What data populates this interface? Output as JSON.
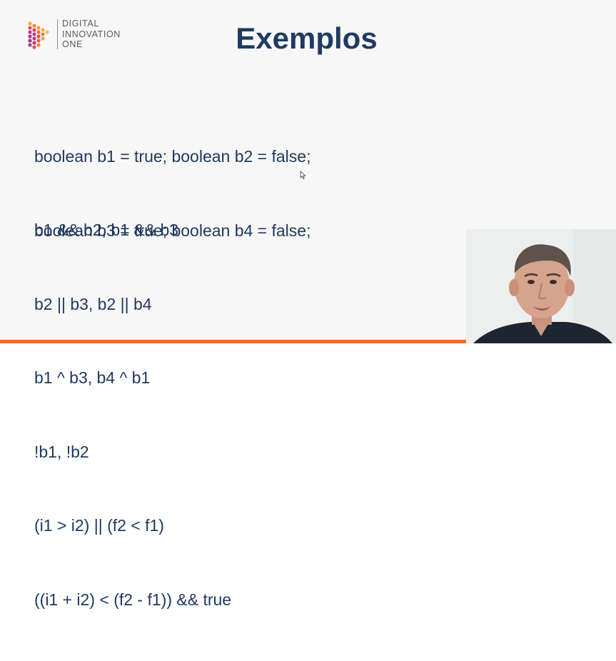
{
  "logo": {
    "icon": "digital-innovation-one-logo",
    "lines": [
      "DIGITAL",
      "INNOVATION",
      "ONE"
    ]
  },
  "slide": {
    "title": "Exemplos",
    "declarations": [
      "boolean b1 = true; boolean b2 = false;",
      "boolean b3 = true; boolean b4 = false;"
    ],
    "expressions": [
      "b1 && b2, b1 && b3",
      "b2 || b3, b2 || b4",
      "b1 ^ b3, b4 ^ b1",
      "!b1, !b2",
      "(i1 > i2) || (f2 < f1)",
      "((i1 + i2) < (f2 - f1)) && true"
    ]
  },
  "colors": {
    "title": "#1f3b63",
    "code_text": "#20395f",
    "accent_bar": "#e8711f"
  },
  "webcam": {
    "icon": "presenter-webcam"
  }
}
